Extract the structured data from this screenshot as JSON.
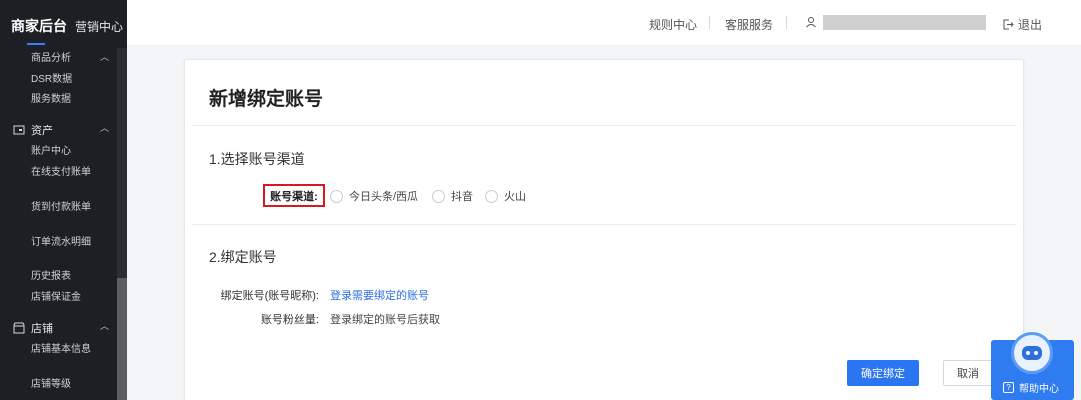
{
  "sidebar": {
    "brand_title": "商家后台",
    "brand_sub": "营销中心",
    "items_top": [
      "商品分析",
      "DSR数据",
      "服务数据"
    ],
    "group_assets": "资产",
    "items_assets": [
      "账户中心",
      "在线支付账单",
      "货到付款账单",
      "订单流水明细",
      "历史报表",
      "店铺保证金"
    ],
    "group_store": "店铺",
    "items_store": [
      "店铺基本信息",
      "店铺等级"
    ]
  },
  "header": {
    "rules_center": "规则中心",
    "customer_service": "客服服务",
    "logout": "退出"
  },
  "page": {
    "title": "新增绑定账号",
    "section1": "1.选择账号渠道",
    "channel_label": "账号渠道:",
    "channel_options": [
      "今日头条/西瓜",
      "抖音",
      "火山"
    ],
    "section2": "2.绑定账号",
    "bind_label": "绑定账号(账号昵称):",
    "bind_link": "登录需要绑定的账号",
    "fans_label": "账号粉丝量:",
    "fans_value": "登录绑定的账号后获取",
    "confirm_button": "确定绑定",
    "cancel_button": "取消"
  },
  "help": {
    "label": "帮助中心"
  },
  "colors": {
    "primary": "#2b76f0",
    "highlight_box": "#d7191f",
    "sidebar_bg": "#1c1f24"
  }
}
